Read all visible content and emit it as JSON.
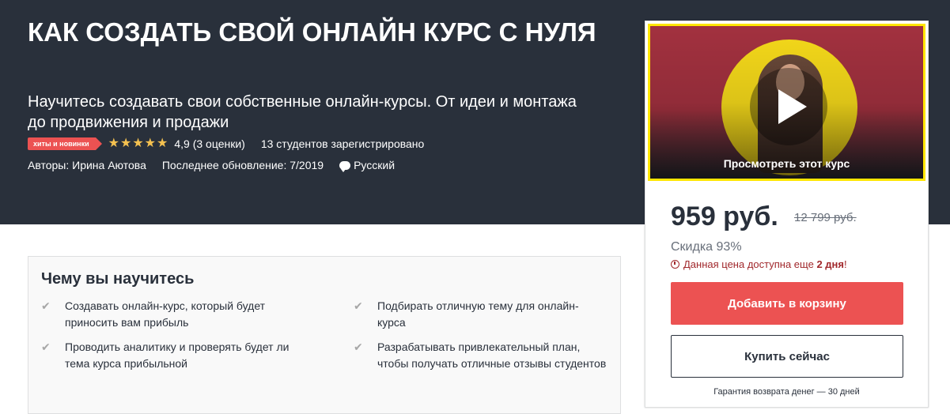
{
  "header": {
    "title": "КАК СОЗДАТЬ СВОЙ ОНЛАЙН КУРС С НУЛЯ",
    "subtitle": "Научитесь создавать свои собственные онлайн-курсы. От идеи и монтажа до продвижения и продажи",
    "badge": "хиты и новинки",
    "stars": 5,
    "rating_text": "4,9 (3 оценки)",
    "students": "13 студентов зарегистрировано",
    "authors": "Авторы: Ирина Аютова",
    "updated": "Последнее обновление: 7/2019",
    "language": "Русский"
  },
  "preview": {
    "label": "Просмотреть этот курс"
  },
  "purchase": {
    "price": "959 руб.",
    "old_price": "12 799 руб.",
    "discount": "Скидка 93%",
    "timer_prefix": "Данная цена доступна еще ",
    "timer_bold": "2 дня",
    "timer_suffix": "!",
    "add_to_cart": "Добавить в корзину",
    "buy_now": "Купить сейчас",
    "guarantee": "Гарантия возврата денег — 30 дней"
  },
  "learn": {
    "title": "Чему вы научитесь",
    "items": [
      "Создавать онлайн-курс, который будет приносить вам прибыль",
      "Подбирать отличную тему для онлайн-курса",
      "Проводить аналитику и проверять будет ли тема курса прибыльной",
      "Разрабатывать привлекательный план, чтобы получать отличные отзывы студентов"
    ]
  },
  "colors": {
    "hero_bg": "#29303b",
    "accent_red": "#ec5252",
    "star": "#f4c150",
    "timer_red": "#a1282c"
  }
}
